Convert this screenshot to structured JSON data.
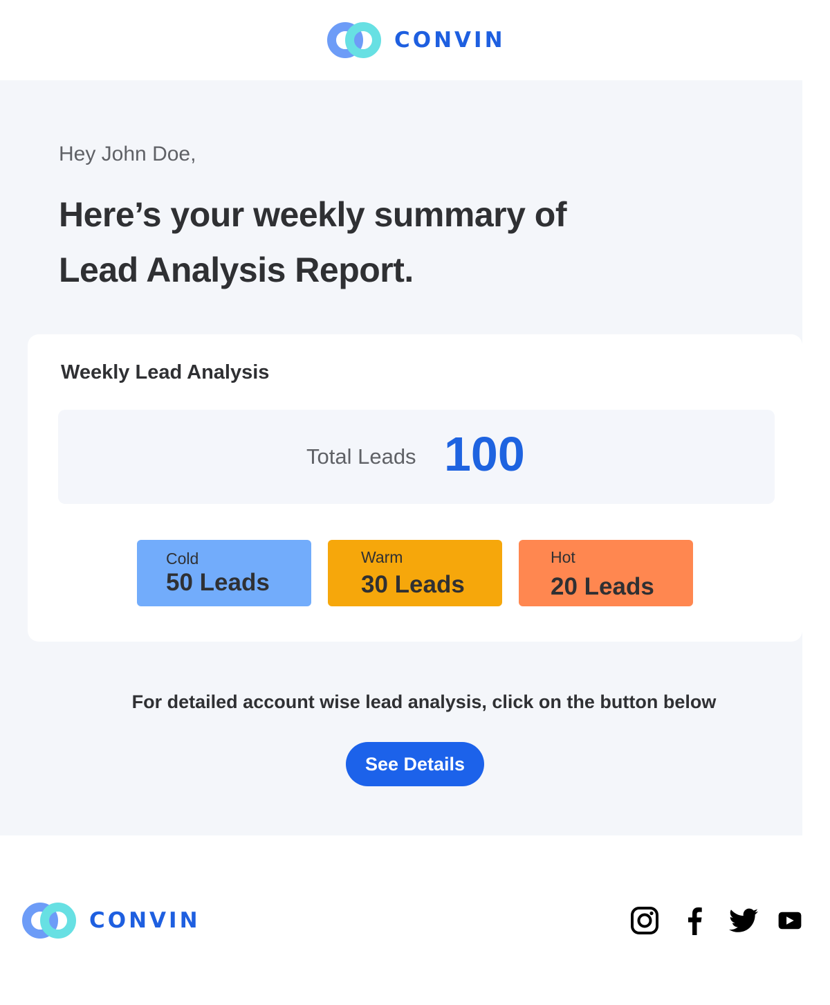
{
  "brand": {
    "name": "CONVIN",
    "colors": {
      "logo_blue": "#6d9cf7",
      "logo_cyan": "#67e0e3",
      "wordmark": "#1e5fe0"
    }
  },
  "intro": {
    "greeting": "Hey John Doe,",
    "headline_line1": "Here’s your weekly summary of",
    "headline_line2": "Lead Analysis Report."
  },
  "card": {
    "title": "Weekly Lead Analysis",
    "total": {
      "label": "Total Leads",
      "value": "100"
    },
    "segments": [
      {
        "label": "Cold",
        "value": "50 Leads",
        "color": "#72acfb"
      },
      {
        "label": "Warm",
        "value": "30 Leads",
        "color": "#f6a70b"
      },
      {
        "label": "Hot",
        "value": "20 Leads",
        "color": "#ff8750"
      }
    ]
  },
  "cta": {
    "text": "For detailed account wise lead analysis, click on the button below",
    "button_label": "See Details",
    "button_color": "#1c62ea"
  },
  "footer": {
    "brand": "CONVIN",
    "social": [
      {
        "name": "instagram",
        "icon": "instagram-icon"
      },
      {
        "name": "facebook",
        "icon": "facebook-icon"
      },
      {
        "name": "twitter",
        "icon": "twitter-icon"
      },
      {
        "name": "youtube",
        "icon": "youtube-icon"
      }
    ]
  }
}
